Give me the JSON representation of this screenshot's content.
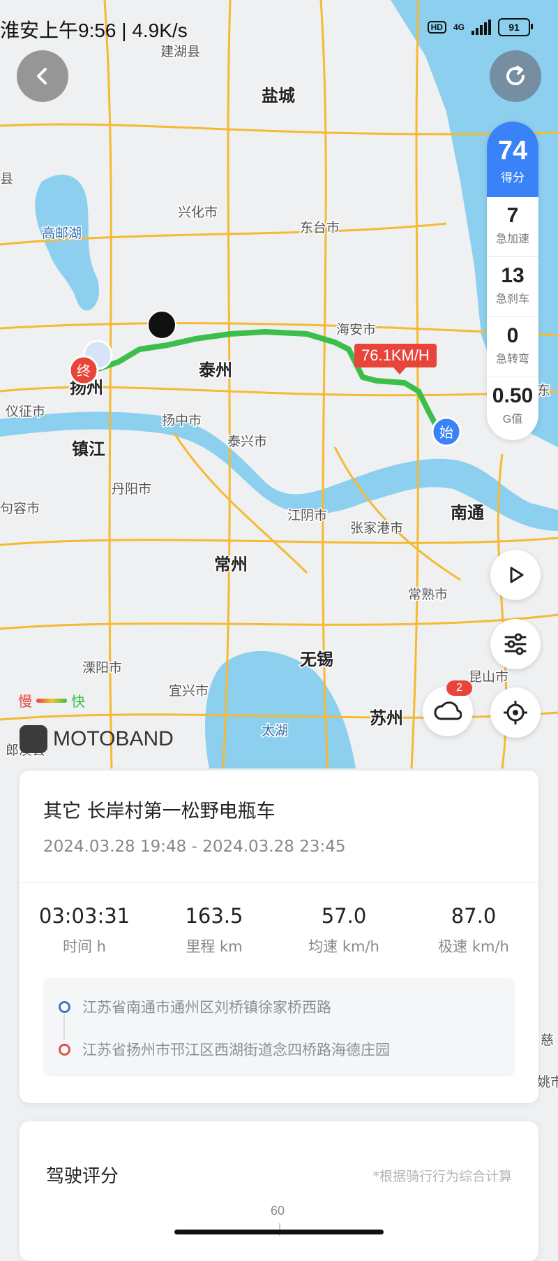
{
  "status_bar": {
    "time_text": "淮安上午9:56 | 4.9K/s",
    "hd_label": "HD",
    "network": "4G",
    "battery": "91"
  },
  "map": {
    "places": [
      {
        "name": "建湖县",
        "major": false
      },
      {
        "name": "盐城",
        "major": true
      },
      {
        "name": "兴化市",
        "major": false
      },
      {
        "name": "东台市",
        "major": false
      },
      {
        "name": "高邮湖",
        "major": false,
        "water": true
      },
      {
        "name": "海安市",
        "major": false
      },
      {
        "name": "泰州",
        "major": true
      },
      {
        "name": "扬州",
        "major": true
      },
      {
        "name": "仪征市",
        "major": false
      },
      {
        "name": "扬中市",
        "major": false
      },
      {
        "name": "泰兴市",
        "major": false
      },
      {
        "name": "镇江",
        "major": true
      },
      {
        "name": "丹阳市",
        "major": false
      },
      {
        "name": "句容市",
        "major": false
      },
      {
        "name": "江阴市",
        "major": false
      },
      {
        "name": "张家港市",
        "major": false
      },
      {
        "name": "南通",
        "major": true
      },
      {
        "name": "常州",
        "major": true
      },
      {
        "name": "常熟市",
        "major": false
      },
      {
        "name": "溧阳市",
        "major": false
      },
      {
        "name": "宜兴市",
        "major": false
      },
      {
        "name": "无锡",
        "major": true
      },
      {
        "name": "昆山市",
        "major": false
      },
      {
        "name": "太湖",
        "major": false,
        "water": true
      },
      {
        "name": "苏州",
        "major": true
      },
      {
        "name": "东",
        "major": false
      },
      {
        "name": "县",
        "major": false
      },
      {
        "name": "郎溪县",
        "major": false
      },
      {
        "name": "慈",
        "major": false
      },
      {
        "name": "姚市",
        "major": false
      }
    ],
    "start_marker": "始",
    "end_marker": "终",
    "speed_tag": "76.1KM/H",
    "legend": {
      "slow": "慢",
      "fast": "快"
    },
    "brand": "MOTOBAND",
    "notification_badge": "2",
    "colors": {
      "route_fast": "#3cbf4a",
      "route_slow": "#e8443a",
      "road": "#f6b931",
      "water": "#8ccfee",
      "accent": "#3a82f7"
    }
  },
  "score_panel": {
    "score": "74",
    "score_label": "得分",
    "metrics": [
      {
        "value": "7",
        "label": "急加速"
      },
      {
        "value": "13",
        "label": "急刹车"
      },
      {
        "value": "0",
        "label": "急转弯"
      },
      {
        "value": "0.50",
        "label": "G值"
      }
    ]
  },
  "trip": {
    "title": "其它 长岸村第一松野电瓶车",
    "time_range": "2024.03.28 19:48 - 2024.03.28 23:45",
    "stats": [
      {
        "value": "03:03:31",
        "label": "时间 h"
      },
      {
        "value": "163.5",
        "label": "里程 km"
      },
      {
        "value": "57.0",
        "label": "均速 km/h"
      },
      {
        "value": "87.0",
        "label": "极速 km/h"
      }
    ],
    "start_address": "江苏省南通市通州区刘桥镇徐家桥西路",
    "end_address": "江苏省扬州市邗江区西湖街道念四桥路海德庄园"
  },
  "driving_score": {
    "title": "驾驶评分",
    "note": "*根据骑行行为综合计算",
    "gauge_label": "60"
  }
}
